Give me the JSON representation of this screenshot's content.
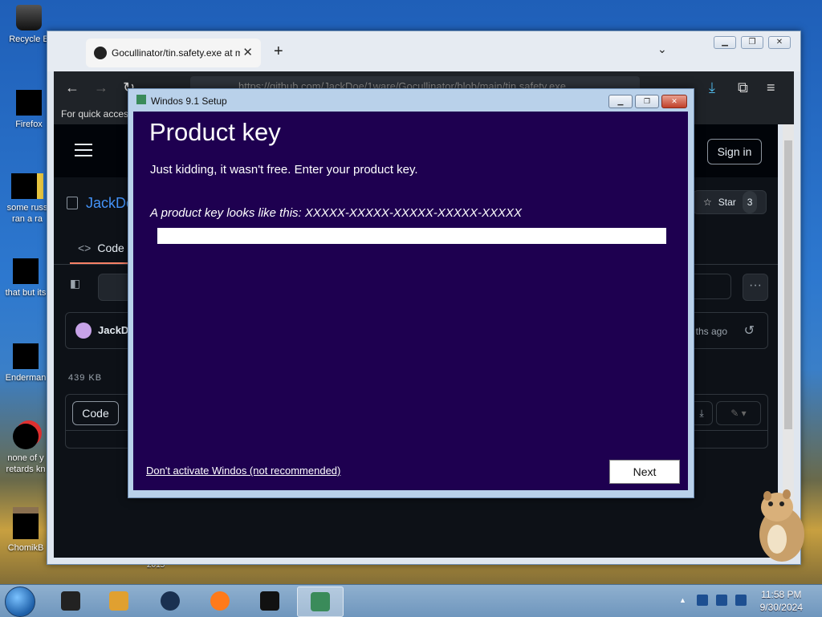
{
  "desktop": {
    "icons": [
      {
        "label": "Recycle B",
        "icon": "recycle-bin-icon"
      },
      {
        "label": "Firefox",
        "icon": "firefox-icon"
      },
      {
        "label": "some russ\nran a ra",
        "icon": "folder-icon"
      },
      {
        "label": "that but its",
        "icon": "document-icon"
      },
      {
        "label": "Enderman",
        "icon": "terminal-icon"
      },
      {
        "label": "none of y\nretards kn",
        "icon": "opera-icon"
      },
      {
        "label": "ChomikB",
        "icon": "hamster-icon"
      }
    ],
    "year_label": "2015"
  },
  "browser": {
    "tab_title": "Gocullinator/tin.safety.exe at m",
    "tab_close": "✕",
    "new_tab": "+",
    "tab_list": "⌄",
    "url": "https://github.com/JackDoe/1ware/Gocullinator/blob/main/tin.safety.exe",
    "bookmarks_text": "For quick access",
    "colors": {
      "toolbar": "#1f2328",
      "page_bg": "#0d1117"
    }
  },
  "github": {
    "sign_in": "Sign in",
    "repo_name": "JackDo",
    "star_label": "Star",
    "star_count": "3",
    "code_tab": "Code",
    "commit_user": "JackD",
    "commit_ago": "ths ago",
    "file_size": "439 KB",
    "code_button": "Code"
  },
  "setup_dialog": {
    "title": "Windos 9.1 Setup",
    "heading": "Product key",
    "subtitle": "Just kidding, it wasn't free. Enter your product key.",
    "example": "A product key looks like this: XXXXX-XXXXX-XXXXX-XXXXX-XXXXX",
    "input_value": "",
    "skip_link": "Don't activate Windos (not recommended)",
    "next_button": "Next",
    "colors": {
      "body": "#1e0050",
      "frame": "#b9d1ea"
    }
  },
  "taskbar": {
    "time": "11:58 PM",
    "date": "9/30/2024",
    "tray_expand": "▲"
  }
}
